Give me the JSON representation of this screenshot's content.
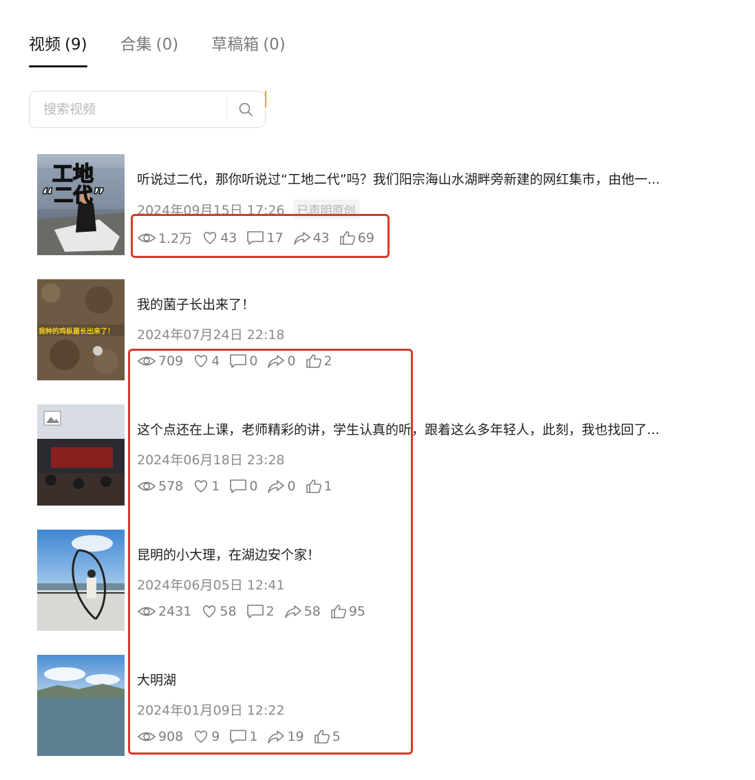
{
  "tabs": [
    {
      "label": "视频",
      "count": "(9)"
    },
    {
      "label": "合集",
      "count": "(0)"
    },
    {
      "label": "草稿箱",
      "count": "(0)"
    }
  ],
  "search": {
    "placeholder": "搜索视频"
  },
  "videos": [
    {
      "title": "听说过二代，那你听说过“工地二代”吗？我们阳宗海山水湖畔旁新建的网红集市，由他一...",
      "date": "2024年09月15日 17:26",
      "tag": "已声明原创",
      "thumb_caption_1": "工地",
      "thumb_caption_2": "“二代”",
      "stats": {
        "views": "1.2万",
        "likes": "43",
        "comments": "17",
        "shares": "43",
        "recommends": "69"
      }
    },
    {
      "title": "我的菌子长出来了！",
      "date": "2024年07月24日 22:18",
      "thumb_caption": "我种的鸡枞菌长出来了！",
      "stats": {
        "views": "709",
        "likes": "4",
        "comments": "0",
        "shares": "0",
        "recommends": "2"
      }
    },
    {
      "title": "这个点还在上课，老师精彩的讲，学生认真的听，跟着这么多年轻人，此刻，我也找回了...",
      "date": "2024年06月18日 23:28",
      "stats": {
        "views": "578",
        "likes": "1",
        "comments": "0",
        "shares": "0",
        "recommends": "1"
      }
    },
    {
      "title": "昆明的小大理，在湖边安个家！",
      "date": "2024年06月05日 12:41",
      "stats": {
        "views": "2431",
        "likes": "58",
        "comments": "2",
        "shares": "58",
        "recommends": "95"
      }
    },
    {
      "title": "大明湖",
      "date": "2024年01月09日 12:22",
      "stats": {
        "views": "908",
        "likes": "9",
        "comments": "1",
        "shares": "19",
        "recommends": "5"
      }
    }
  ],
  "colors": {
    "highlight": "#d33a2b",
    "text": "#1e1e1e",
    "muted": "#8a8a8a"
  }
}
